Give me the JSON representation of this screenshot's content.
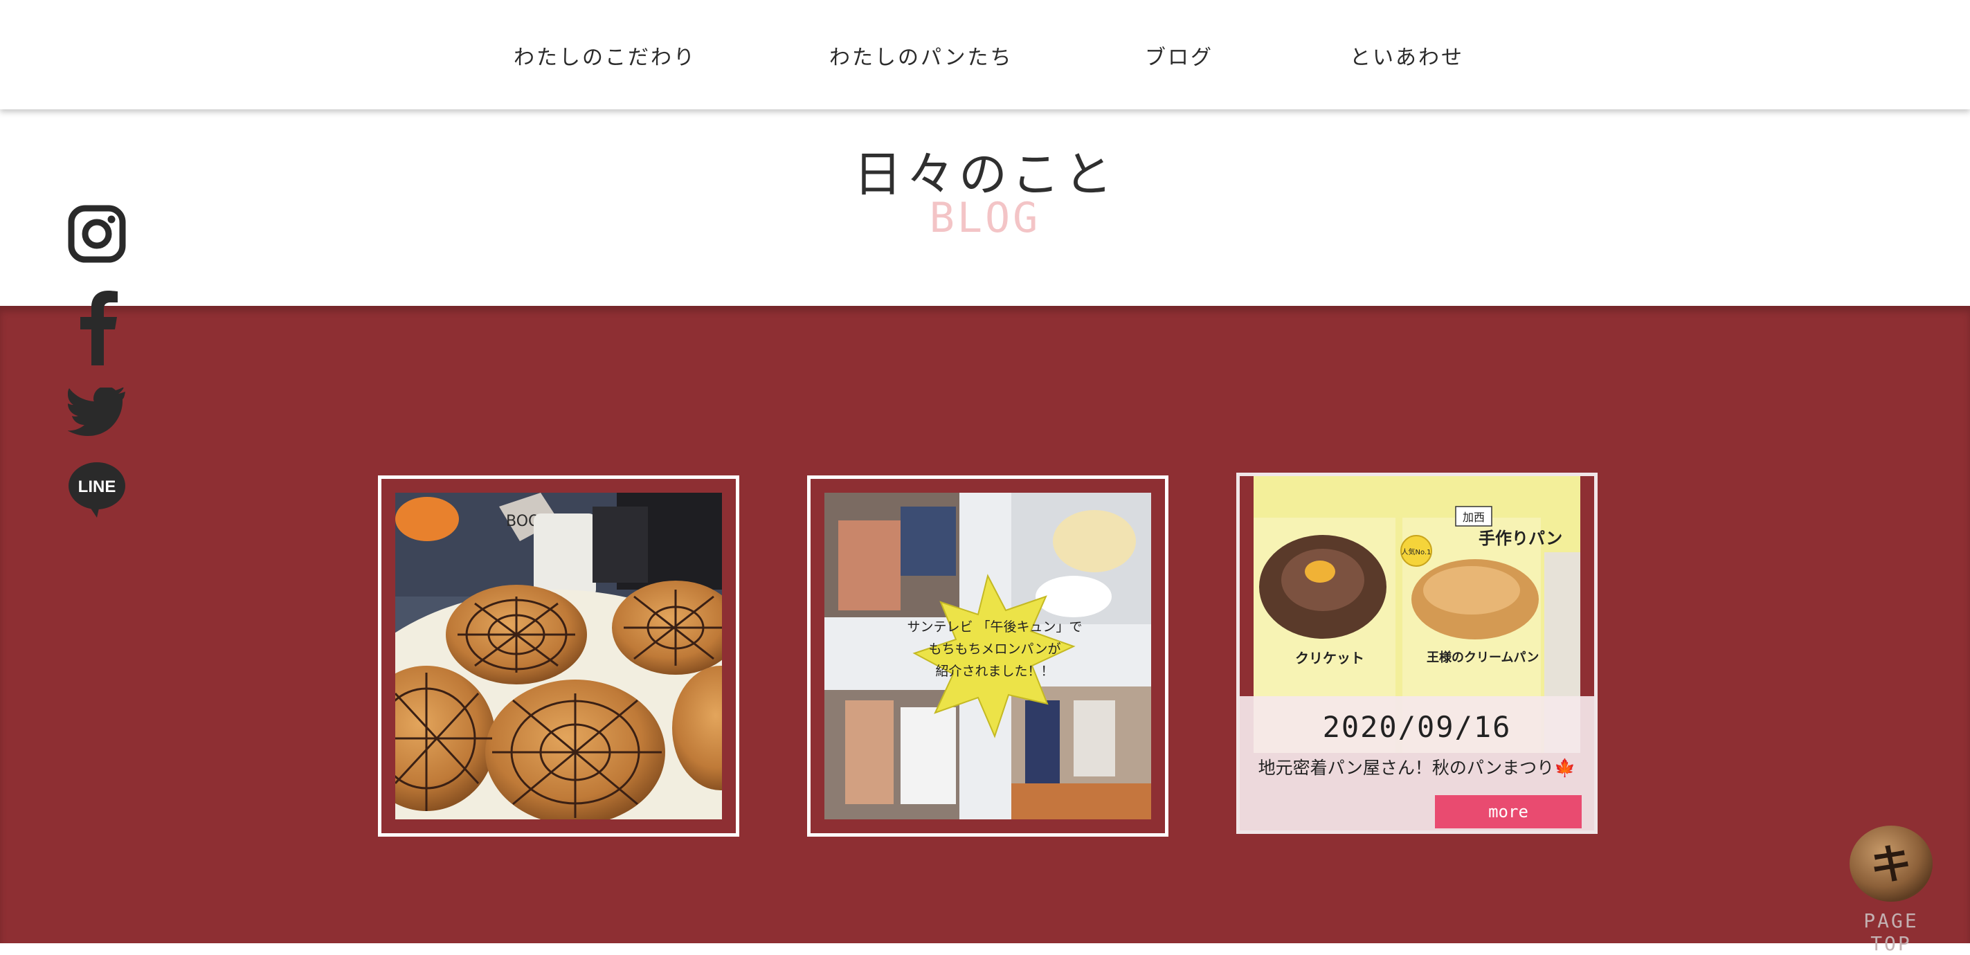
{
  "nav": {
    "items": [
      {
        "label": "わたしのこだわり"
      },
      {
        "label": "わたしのパンたち"
      },
      {
        "label": "ブログ"
      },
      {
        "label": "といあわせ"
      }
    ]
  },
  "header": {
    "title": "日々のこと",
    "subtitle": "BLOG"
  },
  "social": {
    "icons": [
      "instagram-icon",
      "facebook-icon",
      "twitter-icon",
      "line-icon"
    ],
    "line_text": "LINE"
  },
  "posts": [
    {
      "image_text": [
        "BOO!"
      ]
    },
    {
      "image_text": [
        "サンテレビ 「午後キュン」で",
        "もちもちメロンパンが",
        "紹介されました！！"
      ]
    },
    {
      "image_text": [
        "手作りパン",
        "クリケット",
        "王様のクリームパン",
        "加西",
        "人気No.1"
      ],
      "date": "2020/09/16",
      "title": "地元密着パン屋さん！秋のパンまつり🍁",
      "more_label": "more"
    }
  ],
  "pagetop": {
    "label": "PAGE TOP",
    "logo_text": "キ"
  },
  "colors": {
    "band": "#8e2f33",
    "subtitle": "#f3c4c6",
    "more_button": "#e94b70",
    "card_border": "#ffffff"
  }
}
